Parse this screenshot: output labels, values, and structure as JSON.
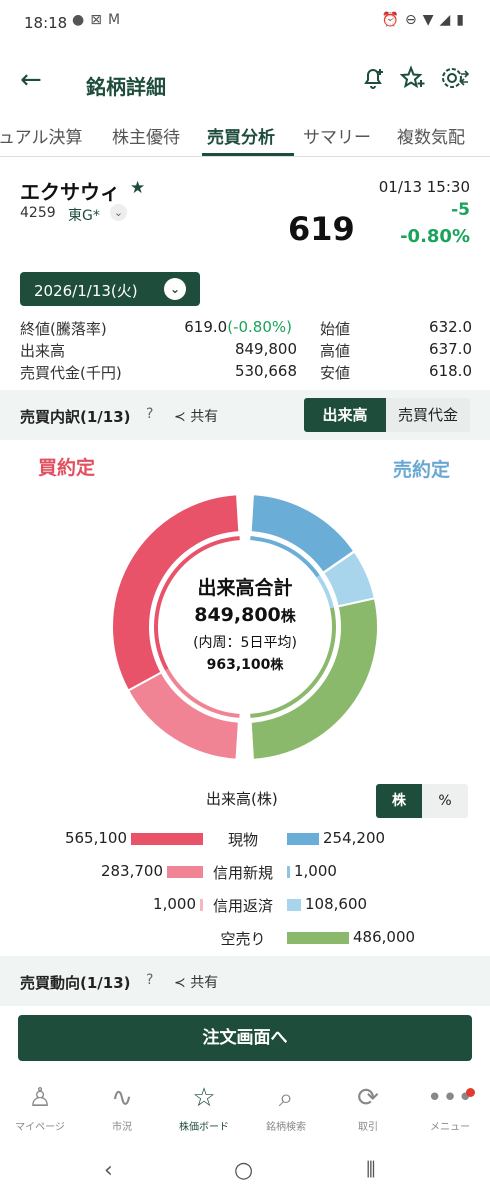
{
  "status_bar": {
    "time": "18:18",
    "left_icons": [
      "line-icon",
      "sim-icon",
      "mail-icon"
    ],
    "right_icons": [
      "alarm-icon",
      "dnd-icon",
      "wifi-icon",
      "signal-icon",
      "battery-icon"
    ]
  },
  "appbar": {
    "title": "銘柄詳細",
    "actions": [
      "bell-plus-icon",
      "star-plus-icon",
      "settings-icon"
    ]
  },
  "tabs": [
    {
      "label": "ュアル決算",
      "active": false
    },
    {
      "label": "株主優待",
      "active": false
    },
    {
      "label": "売買分析",
      "active": true
    },
    {
      "label": "サマリー",
      "active": false
    },
    {
      "label": "複数気配",
      "active": false
    }
  ],
  "stock": {
    "name": "エクサウィ",
    "code": "4259",
    "market": "東G*",
    "price": "619",
    "datetime": "01/13 15:30",
    "change": "-5",
    "change_pct": "-0.80%"
  },
  "date_selector": "2026/1/13(火)",
  "stats": {
    "close_label": "終値(騰落率)",
    "close_value": "619.0",
    "close_pct": "(-0.80%)",
    "volume_label": "出来高",
    "volume_value": "849,800",
    "turnover_label": "売買代金(千円)",
    "turnover_value": "530,668",
    "open_label": "始値",
    "open_value": "632.0",
    "high_label": "高値",
    "high_value": "637.0",
    "low_label": "安値",
    "low_value": "618.0"
  },
  "breakdown_section": {
    "title": "売買内訳(1/13)",
    "help": "?",
    "share": "共有",
    "toggle_left": "出来高",
    "toggle_right": "売買代金"
  },
  "buy_label": "買約定",
  "sell_label": "売約定",
  "donut_center": {
    "title": "出来高合計",
    "total": "849,800",
    "unit": "株",
    "sub": "(内周：5日平均)",
    "avg": "963,100",
    "avg_unit": "株"
  },
  "chart_data": {
    "type": "pie",
    "title": "出来高(株)",
    "unit_toggle": [
      "株",
      "%"
    ],
    "buy_series": [
      {
        "name": "現物",
        "value": 565100,
        "color": "#e8536a"
      },
      {
        "name": "信用新規",
        "value": 283700,
        "color": "#f08494"
      },
      {
        "name": "信用返済",
        "value": 1000,
        "color": "#f6b6c0"
      }
    ],
    "sell_series": [
      {
        "name": "現物",
        "value": 254200,
        "color": "#6aaed8"
      },
      {
        "name": "信用新規",
        "value": 1000,
        "color": "#8fc3e4"
      },
      {
        "name": "信用返済",
        "value": 108600,
        "color": "#a9d5ec"
      },
      {
        "name": "空売り",
        "value": 486000,
        "color": "#8ab96c"
      }
    ],
    "rows": [
      {
        "buy": "565,100",
        "label": "現物",
        "sell": "254,200"
      },
      {
        "buy": "283,700",
        "label": "信用新規",
        "sell": "1,000"
      },
      {
        "buy": "1,000",
        "label": "信用返済",
        "sell": "108,600"
      },
      {
        "buy": "",
        "label": "空売り",
        "sell": "486,000"
      }
    ]
  },
  "trend_section": {
    "title": "売買動向(1/13)",
    "help": "?",
    "share": "共有"
  },
  "order_button": "注文画面へ",
  "bottom_nav": [
    {
      "label": "マイページ",
      "icon": "person-icon",
      "glyph": "♙"
    },
    {
      "label": "市況",
      "icon": "market-icon",
      "glyph": "∿"
    },
    {
      "label": "株価ボード",
      "icon": "star-icon",
      "glyph": "☆",
      "active": true
    },
    {
      "label": "銘柄検索",
      "icon": "search-icon",
      "glyph": "⌕"
    },
    {
      "label": "取引",
      "icon": "trade-icon",
      "glyph": "⟳"
    },
    {
      "label": "メニュー",
      "icon": "menu-icon",
      "glyph": "•••"
    }
  ]
}
